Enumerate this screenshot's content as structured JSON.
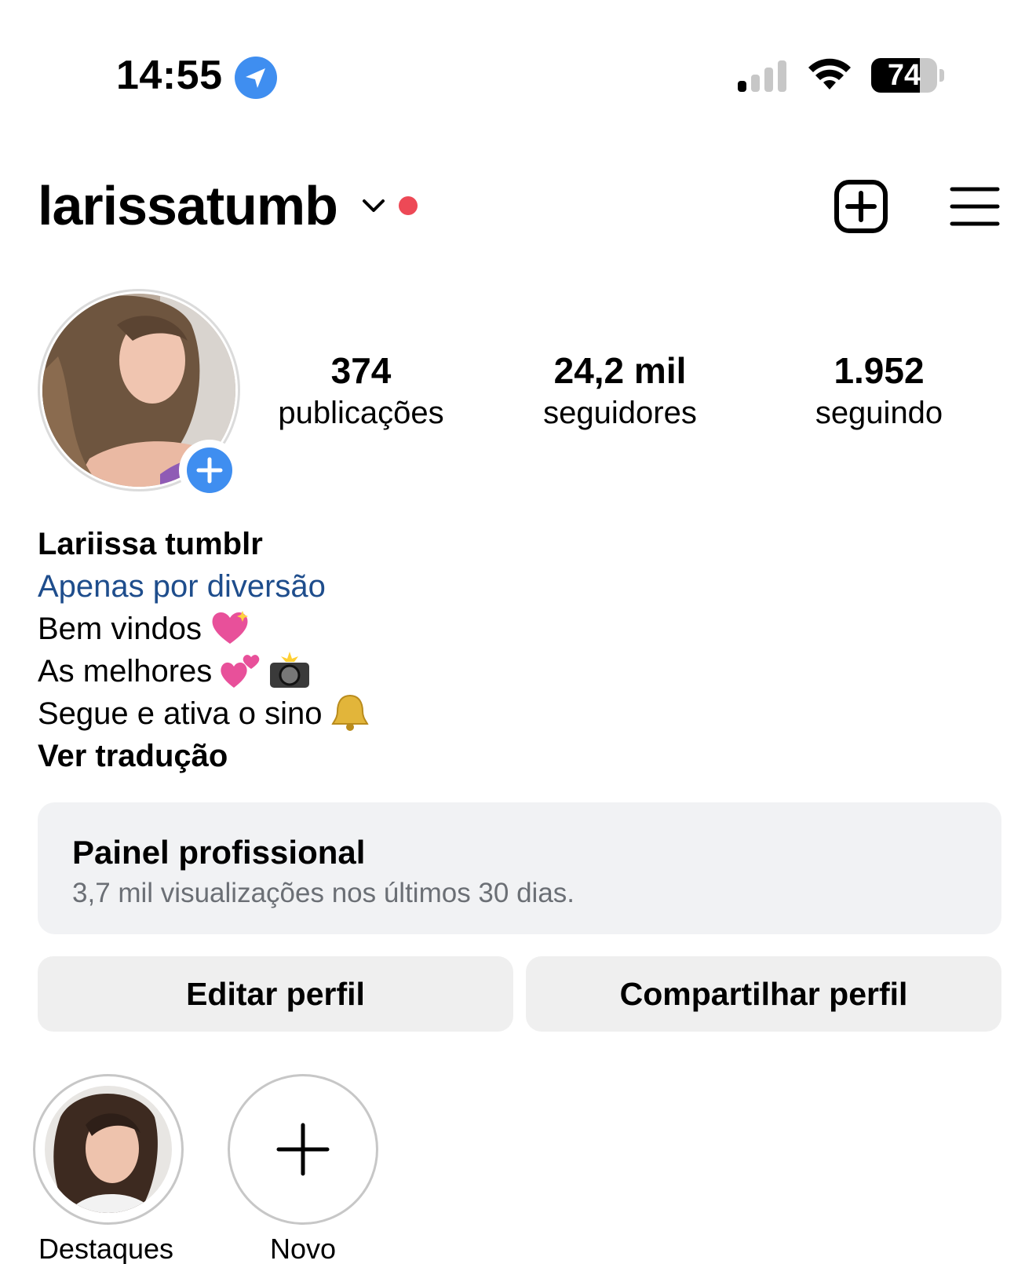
{
  "status_bar": {
    "time": "14:55",
    "battery": "74",
    "battery_level": 0.74
  },
  "header": {
    "username": "larissatumb"
  },
  "profile": {
    "stats": [
      {
        "value": "374",
        "label": "publicações"
      },
      {
        "value": "24,2 mil",
        "label": "seguidores"
      },
      {
        "value": "1.952",
        "label": "seguindo"
      }
    ],
    "name": "Lariissa tumblr",
    "category": "Apenas por diversão",
    "bio_lines": [
      "Bem vindos",
      "As melhores",
      "Segue e ativa o sino"
    ],
    "translate_link": "Ver tradução"
  },
  "dashboard": {
    "title": "Painel profissional",
    "subtitle": "3,7 mil visualizações nos últimos 30 dias."
  },
  "actions": {
    "edit": "Editar perfil",
    "share": "Compartilhar perfil"
  },
  "highlights": [
    {
      "label": "Destaques"
    },
    {
      "label": "Novo"
    }
  ],
  "colors": {
    "accent_blue": "#3f8ef0",
    "category_link": "#1e4d8c",
    "notification_dot": "#ed4956",
    "button_bg": "#efefef",
    "panel_bg": "#f1f2f4"
  }
}
